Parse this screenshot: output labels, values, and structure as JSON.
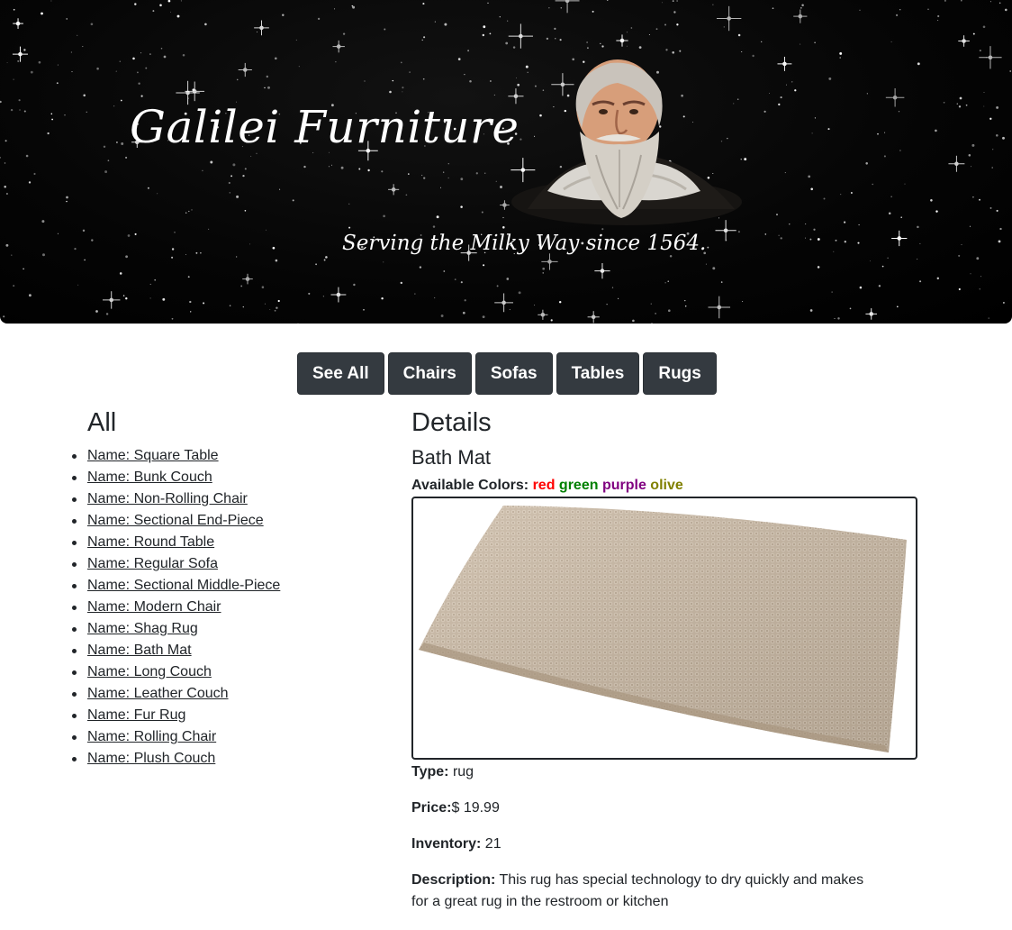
{
  "header": {
    "title": "Galilei Furniture",
    "tagline": "Serving the Milky Way since 1564."
  },
  "nav": {
    "buttons": [
      "See All",
      "Chairs",
      "Sofas",
      "Tables",
      "Rugs"
    ]
  },
  "list": {
    "heading": "All",
    "items": [
      "Name: Square Table",
      "Name: Bunk Couch",
      "Name: Non-Rolling Chair",
      "Name: Sectional End-Piece",
      "Name: Round Table",
      "Name: Regular Sofa",
      "Name: Sectional Middle-Piece",
      "Name: Modern Chair",
      "Name: Shag Rug",
      "Name: Bath Mat",
      "Name: Long Couch",
      "Name: Leather Couch",
      "Name: Fur Rug",
      "Name: Rolling Chair",
      "Name: Plush Couch"
    ]
  },
  "details": {
    "heading": "Details",
    "product_name": "Bath Mat",
    "colors_label": "Available Colors:",
    "colors": [
      {
        "name": "red",
        "hex": "#ff0000"
      },
      {
        "name": "green",
        "hex": "#008000"
      },
      {
        "name": "purple",
        "hex": "#800080"
      },
      {
        "name": "olive",
        "hex": "#808000"
      }
    ],
    "type_label": "Type:",
    "type_value": "rug",
    "price_label": "Price:",
    "price_value": "$ 19.99",
    "inventory_label": "Inventory:",
    "inventory_value": "21",
    "description_label": "Description:",
    "description_value": "This rug has special technology to dry quickly and makes for a great rug in the restroom or kitchen"
  },
  "icons": {
    "portrait": "galileo-portrait-image",
    "product_photo": "bath-mat-photo"
  },
  "colors": {
    "nav_button_bg": "#343a40",
    "text": "#212529",
    "banner_bg": "#000000"
  }
}
